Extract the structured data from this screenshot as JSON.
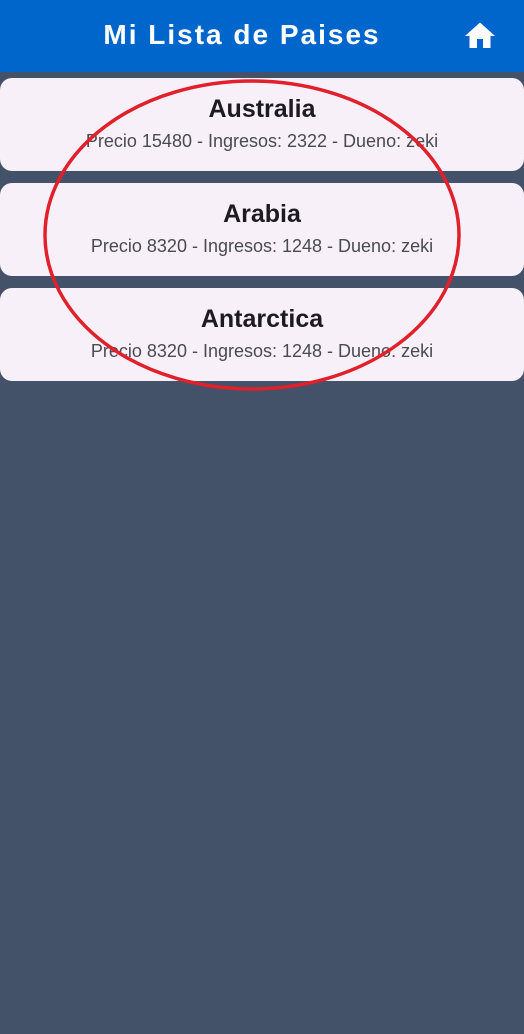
{
  "app_bar": {
    "title": "Mi Lista de Paises",
    "home_icon": "home-icon",
    "color": "#0066cc"
  },
  "countries": [
    {
      "name": "Australia",
      "details": "Precio 15480 - Ingresos: 2322 - Dueno: zeki"
    },
    {
      "name": "Arabia",
      "details": "Precio 8320 - Ingresos: 1248 - Dueno: zeki"
    },
    {
      "name": "Antarctica",
      "details": "Precio 8320 - Ingresos: 1248 - Dueno: zeki"
    }
  ],
  "colors": {
    "background": "#435268",
    "card": "#f7f0f9",
    "annotation": "#e0202a"
  }
}
